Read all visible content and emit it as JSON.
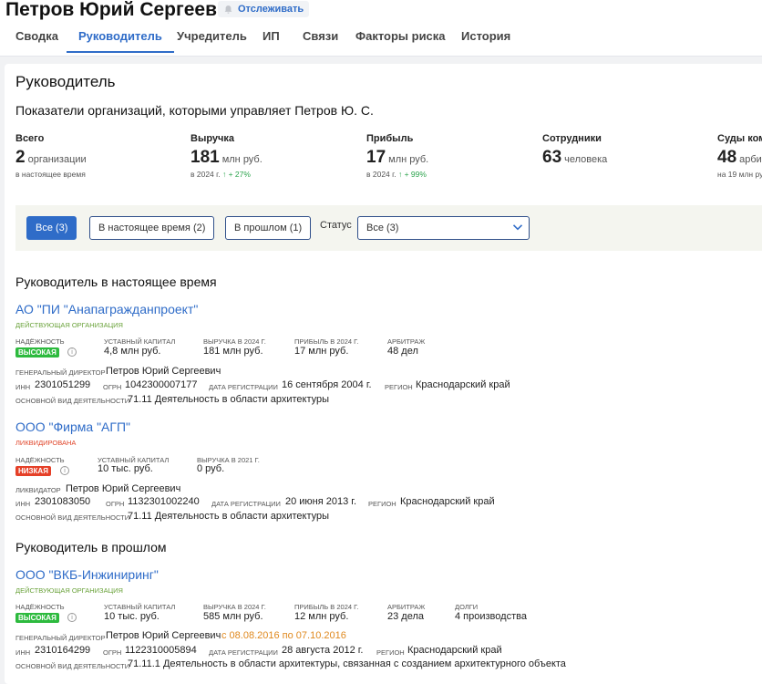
{
  "header": {
    "person_name": "Петров Юрий Сергеевич",
    "track_label": "Отслеживать",
    "tabs": [
      {
        "label": "Сводка"
      },
      {
        "label": "Руководитель",
        "active": true
      },
      {
        "label": "Учредитель"
      },
      {
        "label": "ИП"
      },
      {
        "label": "Связи"
      },
      {
        "label": "Факторы риска"
      },
      {
        "label": "История"
      }
    ]
  },
  "page": {
    "title": "Руководитель",
    "subtitle": "Показатели организаций, которыми управляет Петров Ю. С."
  },
  "stats": [
    {
      "label": "Всего",
      "value": "2",
      "unit": "организации",
      "sub": "в настоящее время",
      "change": ""
    },
    {
      "label": "Выручка",
      "value": "181",
      "unit": "млн руб.",
      "sub": "в 2024 г.",
      "change": "↑ + 27%"
    },
    {
      "label": "Прибыль",
      "value": "17",
      "unit": "млн руб.",
      "sub": "в 2024 г.",
      "change": "↑ + 99%"
    },
    {
      "label": "Сотрудники",
      "value": "63",
      "unit": "человека",
      "sub": "",
      "change": ""
    },
    {
      "label": "Суды ком",
      "value": "48",
      "unit": "арби",
      "sub": "на 19 млн ру",
      "change": ""
    }
  ],
  "filters": {
    "all": "Все (3)",
    "current": "В настоящее время (2)",
    "past": "В прошлом (1)",
    "status_label": "Статус",
    "status_value": "Все (3)"
  },
  "sections": {
    "current": "Руководитель в настоящее время",
    "past": "Руководитель в прошлом"
  },
  "labels": {
    "reliability": "НАДЁЖНОСТЬ",
    "capital": "УСТАВНЫЙ КАПИТАЛ",
    "revenue_2024": "ВЫРУЧКА В 2024 Г.",
    "profit_2024": "ПРИБЫЛЬ В 2024 Г.",
    "revenue_2021": "ВЫРУЧКА В 2021 Г.",
    "arbitration": "АРБИТРАЖ",
    "debts": "ДОЛГИ",
    "gen_director": "ГЕНЕРАЛЬНЫЙ ДИРЕКТОР",
    "liquidator": "ЛИКВИДАТОР",
    "inn": "ИНН",
    "ogrn": "ОГРН",
    "reg_date": "ДАТА РЕГИСТРАЦИИ",
    "region": "РЕГИОН",
    "activity": "ОСНОВНОЙ ВИД ДЕЯТЕЛЬНОСТИ",
    "info": "i"
  },
  "orgs": [
    {
      "name": "АО \"ПИ \"Анапагражданпроект\"",
      "status": "ДЕЙСТВУЮЩАЯ ОРГАНИЗАЦИЯ",
      "reliability": "ВЫСОКАЯ",
      "capital": "4,8 млн руб.",
      "revenue": "181 млн руб.",
      "profit": "17 млн руб.",
      "arbitration": "48 дел",
      "person": "Петров Юрий Сергеевич",
      "inn": "2301051299",
      "ogrn": "1042300007177",
      "reg_date": "16 сентября 2004 г.",
      "region": "Краснодарский край",
      "activity": "71.11 Деятельность в области архитектуры"
    },
    {
      "name": "ООО \"Фирма \"АГП\"",
      "status": "ЛИКВИДИРОВАНА",
      "reliability": "НИЗКАЯ",
      "capital": "10 тыс. руб.",
      "revenue": "0 руб.",
      "person": "Петров Юрий Сергеевич",
      "inn": "2301083050",
      "ogrn": "1132301002240",
      "reg_date": "20 июня 2013 г.",
      "region": "Краснодарский край",
      "activity": "71.11 Деятельность в области архитектуры"
    },
    {
      "name": "ООО \"ВКБ-Инжиниринг\"",
      "status": "ДЕЙСТВУЮЩАЯ ОРГАНИЗАЦИЯ",
      "reliability": "ВЫСОКАЯ",
      "capital": "10 тыс. руб.",
      "revenue": "585 млн руб.",
      "profit": "12 млн руб.",
      "arbitration": "23 дела",
      "debts": "4 производства",
      "person": "Петров Юрий Сергеевич",
      "period": "с 08.08.2016 по 07.10.2016",
      "inn": "2310164299",
      "ogrn": "1122310005894",
      "reg_date": "28 августа 2012 г.",
      "region": "Краснодарский край",
      "activity": "71.11.1 Деятельность в области архитектуры, связанная с созданием архитектурного объекта"
    }
  ],
  "colors": {
    "accent": "#2f6cc8",
    "high": "#2dba3e",
    "low": "#e54028",
    "period": "#e08a20"
  }
}
